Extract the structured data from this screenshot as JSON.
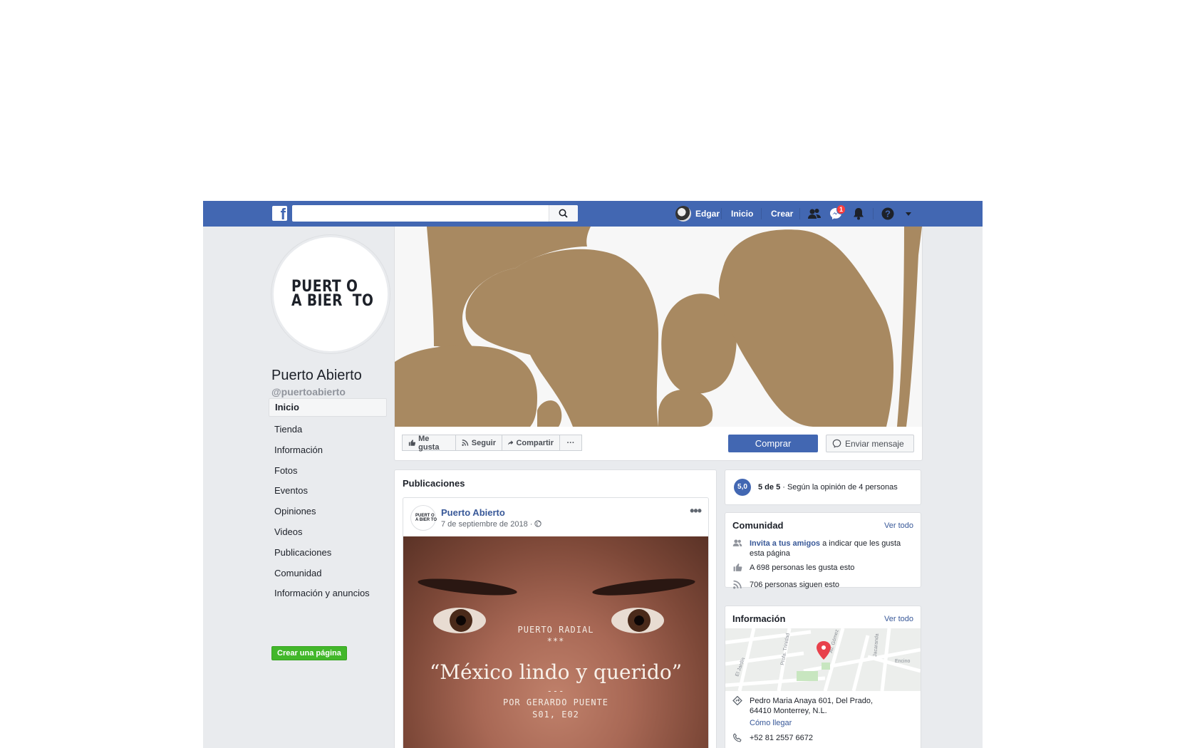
{
  "topbar": {
    "logo": "f",
    "search_placeholder": "",
    "user_name": "Edgar",
    "nav_home": "Inicio",
    "nav_create": "Crear",
    "messages_badge": "1"
  },
  "page": {
    "logo_text": "PUERT O\nA BIER  TO",
    "logo_small": "PUERT O\nA BIER TO",
    "name": "Puerto Abierto",
    "handle": "@puertoabierto"
  },
  "sidebar": {
    "items": [
      {
        "label": "Inicio"
      },
      {
        "label": "Tienda"
      },
      {
        "label": "Información"
      },
      {
        "label": "Fotos"
      },
      {
        "label": "Eventos"
      },
      {
        "label": "Opiniones"
      },
      {
        "label": "Videos"
      },
      {
        "label": "Publicaciones"
      },
      {
        "label": "Comunidad"
      },
      {
        "label": "Información y anuncios"
      }
    ],
    "create_page": "Crear una página"
  },
  "actions": {
    "like": "Me gusta",
    "follow": "Seguir",
    "share": "Compartir",
    "more": "···",
    "buy": "Comprar",
    "message": "Enviar mensaje"
  },
  "posts": {
    "title": "Publicaciones",
    "post": {
      "author": "Puerto Abierto",
      "date": "7 de septiembre de 2018 ·",
      "image": {
        "kicker": "PUERTO RADIAL",
        "stars": "***",
        "title": "“México lindo y querido”",
        "divider": "---",
        "byline": "POR GERARDO PUENTE",
        "episode": "S01, E02"
      }
    }
  },
  "rating": {
    "score": "5,0",
    "bold": "5 de 5",
    "text": " · Según la opinión de 4 personas"
  },
  "community": {
    "title": "Comunidad",
    "see_all": "Ver todo",
    "invite_link": "Invita a tus amigos",
    "invite_rest": " a indicar que les gusta esta página",
    "likes": "A 698 personas les gusta esto",
    "follows": "706 personas siguen esto"
  },
  "info": {
    "title": "Información",
    "see_all": "Ver todo",
    "address": "Pedro Maria Anaya 601, Del Prado, 64410 Monterrey, N.L.",
    "directions": "Cómo llegar",
    "phone": "+52 81 2557 6672",
    "map_labels": [
      "Av. Gómez Mo",
      "Profa. Trinidad",
      "El Jardín",
      "Jacaranda",
      "Encino"
    ]
  },
  "colors": {
    "brand": "#4267b2",
    "cover_shape": "#a88961",
    "badge": "#fa3e3e",
    "create_green": "#42b72a",
    "link": "#385898"
  },
  "icons": [
    "facebook-logo-icon",
    "search-icon",
    "friends-icon",
    "messenger-icon",
    "bell-icon",
    "help-icon",
    "caret-down-icon",
    "thumbs-up-icon",
    "rss-icon",
    "share-icon",
    "globe-icon",
    "messenger-icon",
    "friends-icon",
    "pin-icon",
    "phone-icon"
  ]
}
